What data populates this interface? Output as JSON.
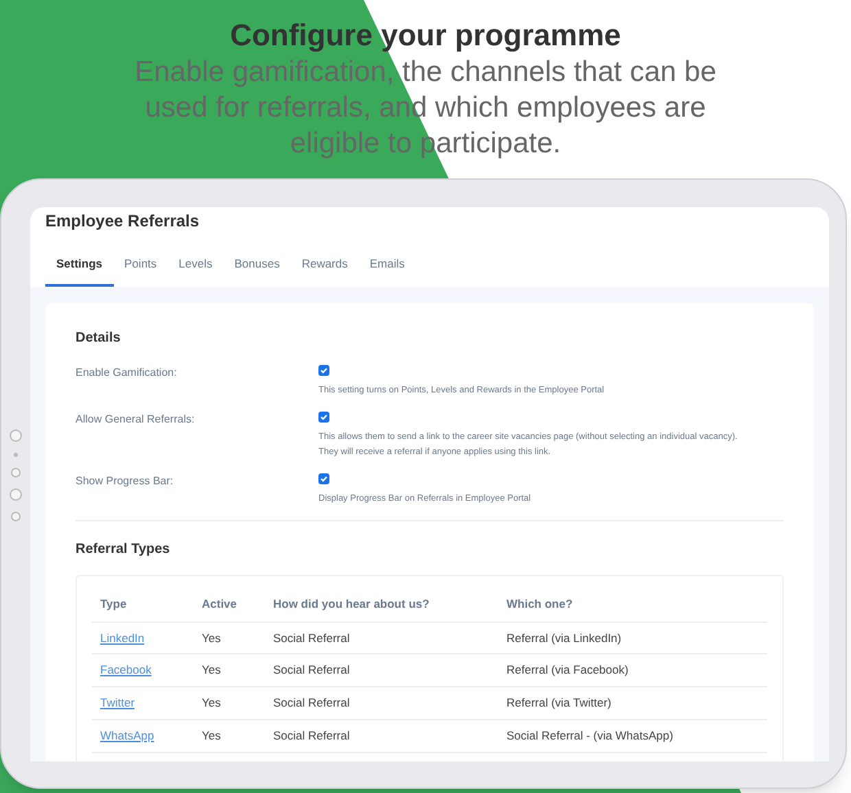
{
  "headline": "Configure your programme",
  "subheadline": "Enable gamification, the channels that can be used for referrals, and which employees are eligible to participate.",
  "page_title": "Employee Referrals",
  "tabs": [
    {
      "label": "Settings",
      "selected": true
    },
    {
      "label": "Points",
      "selected": false
    },
    {
      "label": "Levels",
      "selected": false
    },
    {
      "label": "Bonuses",
      "selected": false
    },
    {
      "label": "Rewards",
      "selected": false
    },
    {
      "label": "Emails",
      "selected": false
    }
  ],
  "details": {
    "title": "Details",
    "settings": [
      {
        "label": "Enable Gamification:",
        "checked": true,
        "help": [
          "This setting turns on Points, Levels and Rewards in the Employee Portal"
        ]
      },
      {
        "label": "Allow General Referrals:",
        "checked": true,
        "help": [
          "This allows them to send a link to the career site vacancies page (without selecting an individual vacancy).",
          "They will receive a referral if anyone applies using this link."
        ]
      },
      {
        "label": "Show Progress Bar:",
        "checked": true,
        "help": [
          "Display Progress Bar on Referrals in Employee Portal"
        ]
      }
    ]
  },
  "referral_types": {
    "title": "Referral Types",
    "columns": [
      "Type",
      "Active",
      "How did you hear about us?",
      "Which one?"
    ],
    "rows": [
      [
        "LinkedIn",
        "Yes",
        "Social Referral",
        "Referral (via LinkedIn)"
      ],
      [
        "Facebook",
        "Yes",
        "Social Referral",
        "Referral (via Facebook)"
      ],
      [
        "Twitter",
        "Yes",
        "Social Referral",
        "Referral (via Twitter)"
      ],
      [
        "WhatsApp",
        "Yes",
        "Social Referral",
        "Social Referral - (via WhatsApp)"
      ]
    ]
  }
}
